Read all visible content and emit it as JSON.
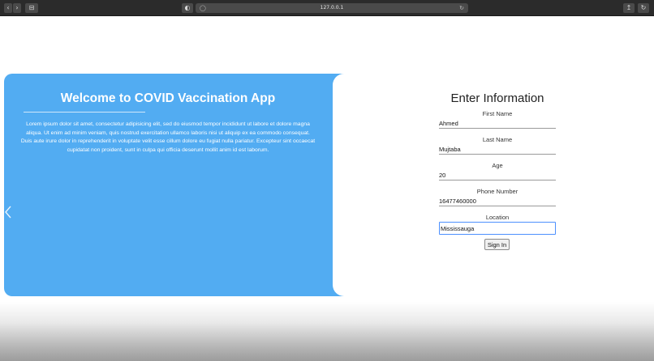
{
  "browser": {
    "url": "127.0.0.1",
    "sidebar_label": "⊟",
    "nav_back_label": "‹",
    "nav_forward_label": "›",
    "shield_label": "◐",
    "share_label": "↥",
    "refresh_label": "↻"
  },
  "welcome": {
    "title": "Welcome to COVID Vaccination App",
    "body": "Lorem ipsum dolor sit amet, consectetur adipisicing elit, sed do eiusmod tempor incididunt ut labore et dolore magna aliqua. Ut enim ad minim veniam, quis nostrud exercitation ullamco laboris nisi ut aliquip ex ea commodo consequat. Duis aute irure dolor in reprehenderit in voluptate velit esse cillum dolore eu fugiat nulla pariatur. Excepteur sint occaecat cupidatat non proident, sunt in culpa qui officia deserunt mollit anim id est laborum."
  },
  "form": {
    "title": "Enter Information",
    "first_name": {
      "label": "First Name",
      "value": "Ahmed"
    },
    "last_name": {
      "label": "Last Name",
      "value": "Mujtaba"
    },
    "age": {
      "label": "Age",
      "value": "20"
    },
    "phone": {
      "label": "Phone Number",
      "value": "16477460000"
    },
    "location": {
      "label": "Location",
      "value": "Mississauga"
    },
    "submit_label": "Sign In"
  },
  "icons": {
    "left_chevron": "chevron-left-icon"
  },
  "colors": {
    "welcome_bg": "#52acf2",
    "focus_ring": "#4d90fe"
  }
}
